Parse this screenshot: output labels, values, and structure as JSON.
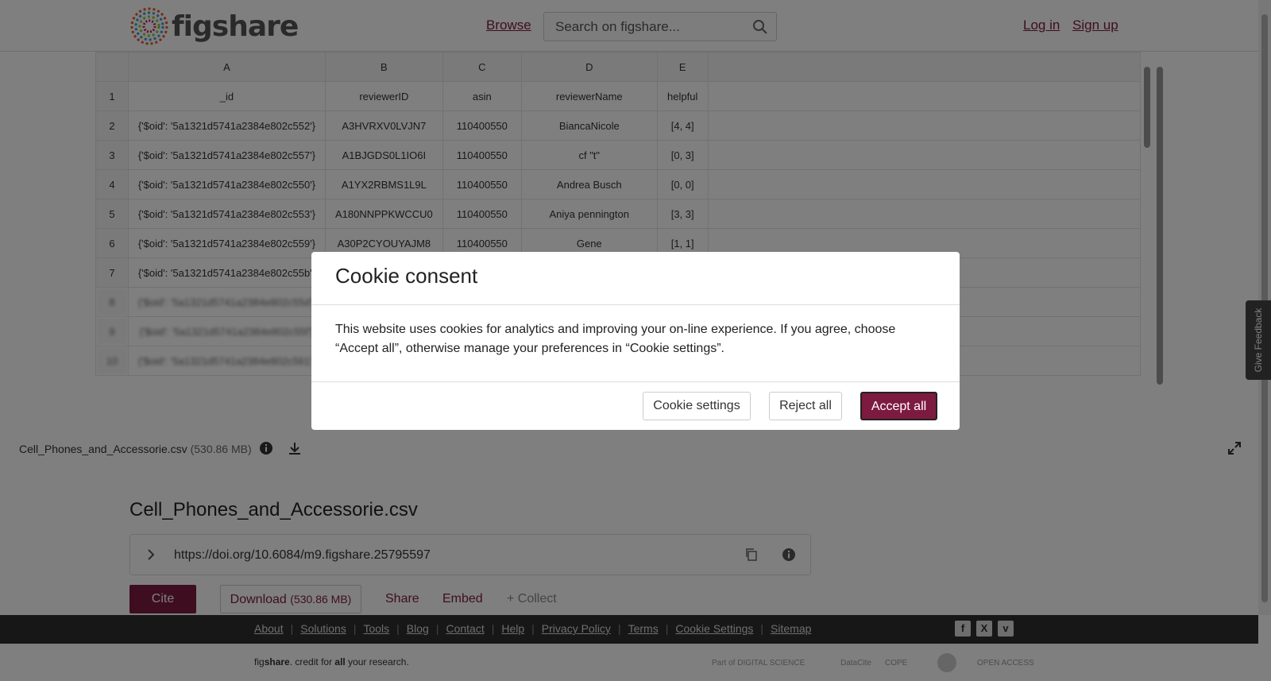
{
  "header": {
    "logo_text": "figshare",
    "browse": "Browse",
    "search_placeholder": "Search on figshare...",
    "login": "Log in",
    "signup": "Sign up"
  },
  "sheet": {
    "columns": [
      "A",
      "B",
      "C",
      "D",
      "E"
    ],
    "rows": [
      {
        "n": "1",
        "cells": [
          "_id",
          "reviewerID",
          "asin",
          "reviewerName",
          "helpful"
        ]
      },
      {
        "n": "2",
        "cells": [
          "{'$oid': '5a1321d5741a2384e802c552'}",
          "A3HVRXV0LVJN7",
          "110400550",
          "BiancaNicole",
          "[4, 4]"
        ]
      },
      {
        "n": "3",
        "cells": [
          "{'$oid': '5a1321d5741a2384e802c557'}",
          "A1BJGDS0L1IO6I",
          "110400550",
          "cf \"t\"",
          "[0, 3]"
        ]
      },
      {
        "n": "4",
        "cells": [
          "{'$oid': '5a1321d5741a2384e802c550'}",
          "A1YX2RBMS1L9L",
          "110400550",
          "Andrea Busch",
          "[0, 0]"
        ]
      },
      {
        "n": "5",
        "cells": [
          "{'$oid': '5a1321d5741a2384e802c553'}",
          "A180NNPPKWCCU0",
          "110400550",
          "Aniya pennington",
          "[3, 3]"
        ]
      },
      {
        "n": "6",
        "cells": [
          "{'$oid': '5a1321d5741a2384e802c559'}",
          "A30P2CYOUYAJM8",
          "110400550",
          "Gene",
          "[1, 1]"
        ]
      },
      {
        "n": "7",
        "cells": [
          "{'$oid': '5a1321d5741a2384e802c55b'}",
          "",
          "",
          "",
          ""
        ]
      }
    ],
    "blurred_rows": [
      {
        "n": "8",
        "cells": [
          "{'$oid': '5a1321d5741a2384e802c55d'}",
          "",
          "",
          "",
          ""
        ]
      },
      {
        "n": "9",
        "cells": [
          "{'$oid': '5a1321d5741a2384e802c55f'}",
          "",
          "",
          "",
          ""
        ]
      },
      {
        "n": "10",
        "cells": [
          "{'$oid': '5a1321d5741a2384e802c561'}",
          "",
          "",
          "",
          ""
        ]
      }
    ]
  },
  "filebar": {
    "filename": "Cell_Phones_and_Accessorie.csv",
    "size": "(530.86 MB)"
  },
  "details": {
    "title": "Cell_Phones_and_Accessorie.csv",
    "doi": "https://doi.org/10.6084/m9.figshare.25795597",
    "cite": "Cite",
    "download": "Download",
    "download_size": "(530.86 MB)",
    "share": "Share",
    "embed": "Embed",
    "collect": "+ Collect"
  },
  "footer": {
    "links": [
      "About",
      "Solutions",
      "Tools",
      "Blog",
      "Contact",
      "Help",
      "Privacy Policy",
      "Terms",
      "Cookie Settings",
      "Sitemap"
    ],
    "tagline_pre": "fig",
    "tagline_bold": "share",
    "tagline_mid": ". credit for ",
    "tagline_all": "all",
    "tagline_post": " your research.",
    "partners": [
      "Part of DIGITAL SCIENCE",
      "DataCite",
      "COPE",
      "",
      "OPEN ACCESS"
    ]
  },
  "feedback": "Give Feedback",
  "cookie": {
    "title": "Cookie consent",
    "body": "This website uses cookies for analytics and improving your on-line experience. If you agree, choose “Accept all”, otherwise manage your preferences in “Cookie settings”.",
    "settings": "Cookie settings",
    "reject": "Reject all",
    "accept": "Accept all"
  },
  "colors": {
    "brand": "#7d1a3f",
    "footer": "#2e2e2e"
  }
}
